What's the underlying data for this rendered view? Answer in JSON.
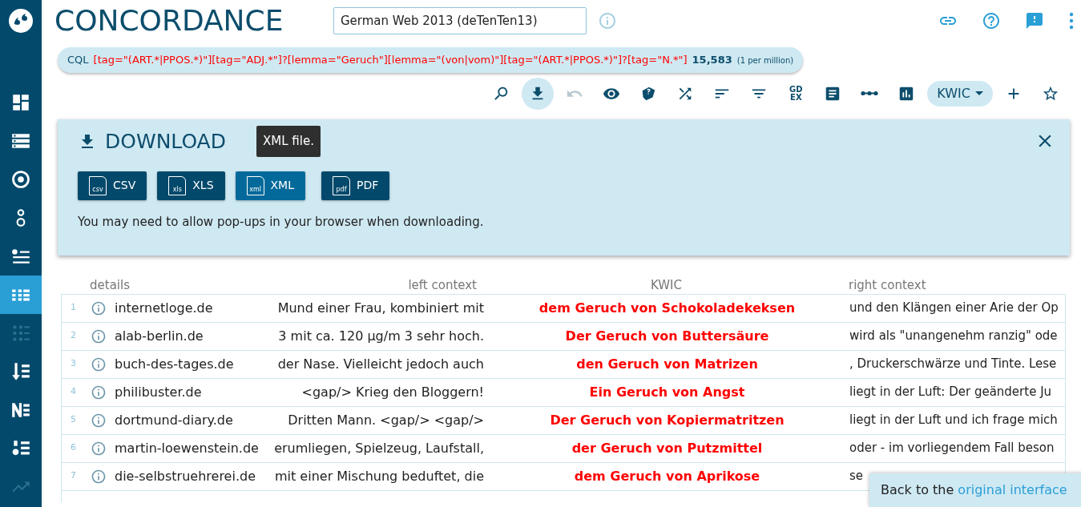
{
  "app": {
    "title": "CONCORDANCE"
  },
  "corpus_select": {
    "value": "German Web 2013 (deTenTen13)"
  },
  "query": {
    "label": "CQL",
    "text": "[tag=\"(ART.*|PPOS.*)\"][tag=\"ADJ.*\"]?[lemma=\"Geruch\"][lemma=\"(von|vom)\"][tag=\"(ART.*|PPOS.*)\"]?[tag=\"N.*\"]",
    "count": "15,583",
    "relative": "(1 per million)"
  },
  "sidebar": {
    "items": [
      {
        "selected": false,
        "disabled": false
      },
      {
        "selected": false,
        "disabled": false
      },
      {
        "selected": false,
        "disabled": false
      },
      {
        "selected": false,
        "disabled": false
      },
      {
        "selected": false,
        "disabled": false
      },
      {
        "selected": true,
        "disabled": false
      },
      {
        "selected": false,
        "disabled": true
      },
      {
        "selected": false,
        "disabled": false
      },
      {
        "selected": false,
        "disabled": false
      },
      {
        "selected": false,
        "disabled": false
      },
      {
        "selected": false,
        "disabled": true
      }
    ]
  },
  "toolbar": {
    "items": [
      {
        "kind": "icon",
        "selected": false,
        "disabled": false
      },
      {
        "kind": "icon",
        "selected": true,
        "disabled": false
      },
      {
        "kind": "icon",
        "selected": false,
        "disabled": true
      },
      {
        "kind": "icon",
        "selected": false,
        "disabled": false
      },
      {
        "kind": "icon",
        "selected": false,
        "disabled": false
      },
      {
        "kind": "icon",
        "selected": false,
        "disabled": false
      },
      {
        "kind": "icon",
        "selected": false,
        "disabled": false
      },
      {
        "kind": "icon",
        "selected": false,
        "disabled": false
      },
      {
        "kind": "text",
        "label": "GD EX",
        "selected": false,
        "disabled": false
      },
      {
        "kind": "icon",
        "selected": false,
        "disabled": false
      },
      {
        "kind": "icon",
        "selected": false,
        "disabled": false
      },
      {
        "kind": "icon",
        "selected": false,
        "disabled": false
      },
      {
        "kind": "dropdown",
        "label": "KWIC",
        "selected": false,
        "disabled": false
      },
      {
        "kind": "icon",
        "selected": false,
        "disabled": false
      },
      {
        "kind": "icon",
        "selected": false,
        "disabled": false
      }
    ]
  },
  "download_panel": {
    "title": "DOWNLOAD",
    "tooltip": "XML file.",
    "buttons": [
      {
        "label": "CSV",
        "file_badge": "csv",
        "selected": false
      },
      {
        "label": "XLS",
        "file_badge": "xls",
        "selected": false
      },
      {
        "label": "XML",
        "file_badge": "xml",
        "selected": true
      },
      {
        "label": "PDF",
        "file_badge": "pdf",
        "selected": false
      }
    ],
    "note": "You may need to allow pop-ups in your browser when downloading."
  },
  "table": {
    "columns": [
      "details",
      "left context",
      "KWIC",
      "right context"
    ],
    "rows": [
      {
        "number": "1",
        "details": "internetloge.de",
        "left": "Mund einer Frau, kombiniert mit",
        "kwic": "dem Geruch von Schokoladekeksen",
        "right": "und den Klängen einer Arie der Op"
      },
      {
        "number": "2",
        "details": "alab-berlin.de",
        "left": "3 mit ca. 120 µg/m 3 sehr hoch.",
        "kwic": "Der Geruch von Buttersäure",
        "right": "wird als \"unangenehm ranzig\" ode"
      },
      {
        "number": "3",
        "details": "buch-des-tages.de",
        "left": "der Nase. Vielleicht jedoch auch",
        "kwic": "den Geruch von Matrizen",
        "right": ", Druckerschwärze und Tinte. Lese"
      },
      {
        "number": "4",
        "details": "philibuster.de",
        "left": "<gap/> Krieg den Bloggern!",
        "kwic": "Ein Geruch von Angst",
        "right": "liegt in der Luft: Der geänderte Ju"
      },
      {
        "number": "5",
        "details": "dortmund-diary.de",
        "left": "Dritten Mann. <gap/> <gap/>",
        "kwic": "Der Geruch von Kopiermatritzen",
        "right": "liegt in der Luft und ich frage mich"
      },
      {
        "number": "6",
        "details": "martin-loewenstein.de",
        "left": "erumliegen, Spielzeug, Laufstall,",
        "kwic": "der Geruch von Putzmittel",
        "right": "oder - im vorliegendem Fall beson"
      },
      {
        "number": "7",
        "details": "die-selbstruehrerei.de",
        "left": "mit einer Mischung beduftet, die",
        "kwic": "dem Geruch von Aprikose",
        "right": "se"
      }
    ]
  },
  "back_popup": {
    "text": "Back to the",
    "link": "original interface"
  }
}
